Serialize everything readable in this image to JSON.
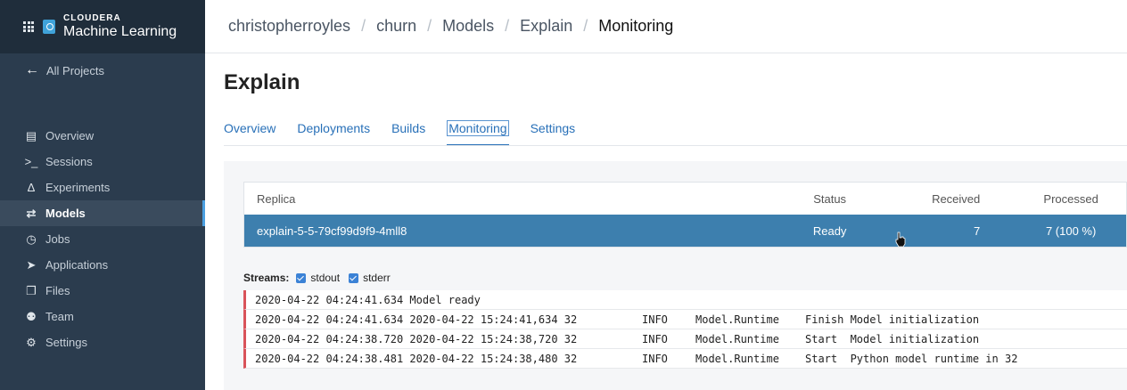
{
  "brand": {
    "line1": "CLOUDERA",
    "line2": "Machine Learning"
  },
  "sidebar": {
    "back_label": "All Projects",
    "items": [
      {
        "label": "Overview",
        "icon": "overview-icon"
      },
      {
        "label": "Sessions",
        "icon": "terminal-icon"
      },
      {
        "label": "Experiments",
        "icon": "flask-icon"
      },
      {
        "label": "Models",
        "icon": "arrows-icon"
      },
      {
        "label": "Jobs",
        "icon": "clock-icon"
      },
      {
        "label": "Applications",
        "icon": "rocket-icon"
      },
      {
        "label": "Files",
        "icon": "files-icon"
      },
      {
        "label": "Team",
        "icon": "team-icon"
      },
      {
        "label": "Settings",
        "icon": "gear-icon"
      }
    ],
    "active": "Models"
  },
  "breadcrumb": [
    "christopherroyles",
    "churn",
    "Models",
    "Explain",
    "Monitoring"
  ],
  "page": {
    "title": "Explain"
  },
  "tabs": [
    "Overview",
    "Deployments",
    "Builds",
    "Monitoring",
    "Settings"
  ],
  "active_tab": "Monitoring",
  "replicas": {
    "headers": {
      "replica": "Replica",
      "status": "Status",
      "received": "Received",
      "processed": "Processed"
    },
    "rows": [
      {
        "replica": "explain-5-5-79cf99d9f9-4mll8",
        "status": "Ready",
        "received": "7",
        "processed": "7 (100 %)"
      }
    ]
  },
  "streams": {
    "label": "Streams:",
    "stdout": "stdout",
    "stderr": "stderr"
  },
  "logs": [
    {
      "ts": "2020-04-22 04:24:41.634 Model ready",
      "level": "",
      "source": "",
      "msg": ""
    },
    {
      "ts": "2020-04-22 04:24:41.634 2020-04-22 15:24:41,634 32",
      "level": "INFO",
      "source": "Model.Runtime",
      "msg": "Finish Model initialization"
    },
    {
      "ts": "2020-04-22 04:24:38.720 2020-04-22 15:24:38,720 32",
      "level": "INFO",
      "source": "Model.Runtime",
      "msg": "Start  Model initialization"
    },
    {
      "ts": "2020-04-22 04:24:38.481 2020-04-22 15:24:38,480 32",
      "level": "INFO",
      "source": "Model.Runtime",
      "msg": "Start  Python model runtime in 32"
    }
  ],
  "colors": {
    "sidebar": "#2b3c4e",
    "accent": "#2870b8",
    "selected_row": "#3d7fae",
    "log_marker": "#d9535a"
  }
}
